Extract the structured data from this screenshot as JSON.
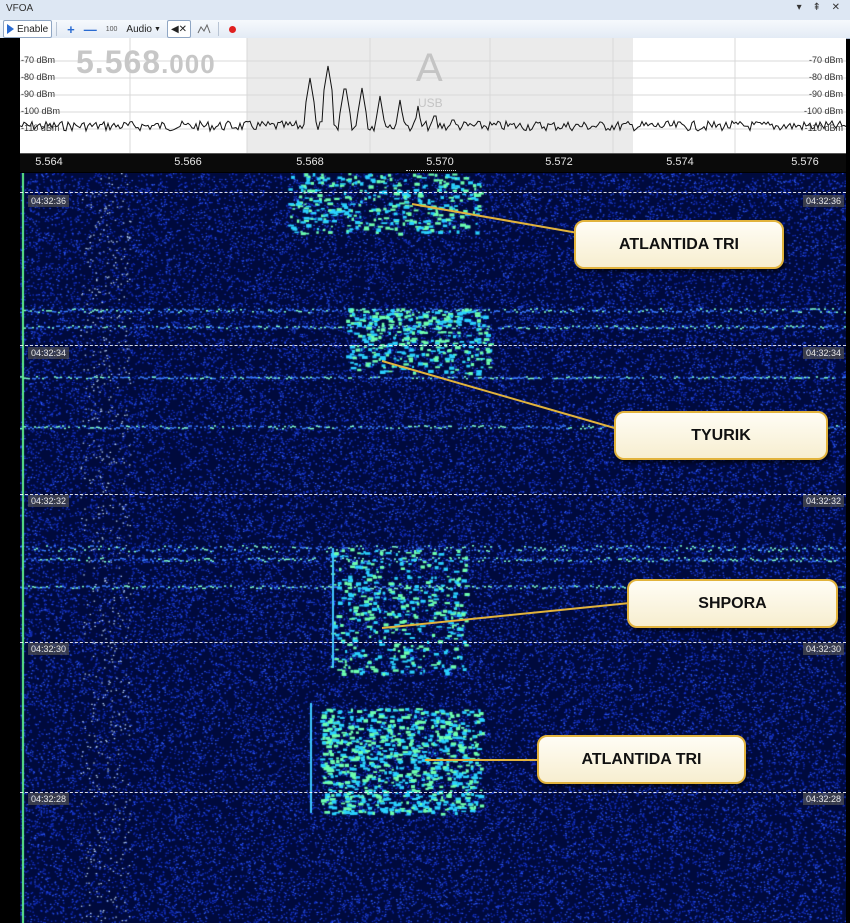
{
  "window": {
    "title": "VFOA",
    "controls": "▾ ⇞ ✕"
  },
  "toolbar": {
    "enable_label": "Enable",
    "zoom_value": "100",
    "audio_label": "Audio"
  },
  "spectrum": {
    "frequency_main": "5.568",
    "frequency_sub": ".000",
    "vfo_letter": "A",
    "mode": "USB",
    "dbm_levels": [
      "-70 dBm",
      "-80 dBm",
      "-90 dBm",
      "-100 dBm",
      "-110 dBm"
    ]
  },
  "ruler": {
    "ticks": [
      "5.564",
      "5.566",
      "5.568",
      "5.570",
      "5.572",
      "5.574",
      "5.576"
    ]
  },
  "waterfall": {
    "timestamps": [
      "04:32:36",
      "04:32:34",
      "04:32:32",
      "04:32:30",
      "04:32:28"
    ]
  },
  "callouts": [
    {
      "label": "ATLANTIDA TRI"
    },
    {
      "label": "TYURIK"
    },
    {
      "label": "SHPORA"
    },
    {
      "label": "ATLANTIDA TRI"
    }
  ],
  "colors": {
    "waterfall_bg": "#000a3d",
    "signal_green": "#5ef08a",
    "callout_border": "#e2b33c",
    "record_red": "#e02020"
  }
}
